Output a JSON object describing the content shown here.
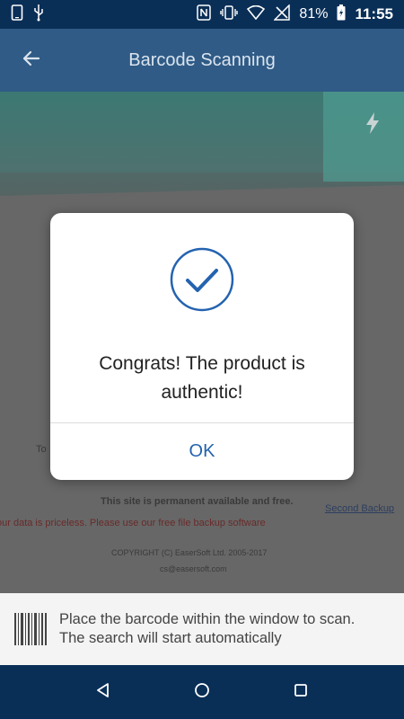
{
  "status_bar": {
    "battery": "81%",
    "time": "11:55",
    "icons": [
      "phone-icon",
      "usb-icon",
      "nfc-icon",
      "vibrate-icon",
      "wifi-icon",
      "no-signal-icon",
      "battery-icon"
    ]
  },
  "app_bar": {
    "title": "Barcode Scanning",
    "back_icon": "arrow-left-icon",
    "flash_icon": "flash-icon"
  },
  "camera_background": {
    "line1": "To",
    "line2": "This site is permanent available and free.",
    "line3": "our data is priceless. Please use our free file backup software",
    "line4": "Second Backup",
    "line5": "COPYRIGHT (C) EaserSoft Ltd. 2005-2017",
    "line6": "cs@easersoft.com"
  },
  "dialog": {
    "message": "Congrats! The product is authentic!",
    "ok_label": "OK",
    "icon": "check-circle-icon",
    "accent_color": "#2463b0"
  },
  "hint": {
    "line1": "Place the barcode within the window to scan.",
    "line2": "The search will start automatically"
  },
  "nav_bar": {
    "icons": [
      "back-triangle-icon",
      "home-circle-icon",
      "recents-square-icon"
    ]
  }
}
